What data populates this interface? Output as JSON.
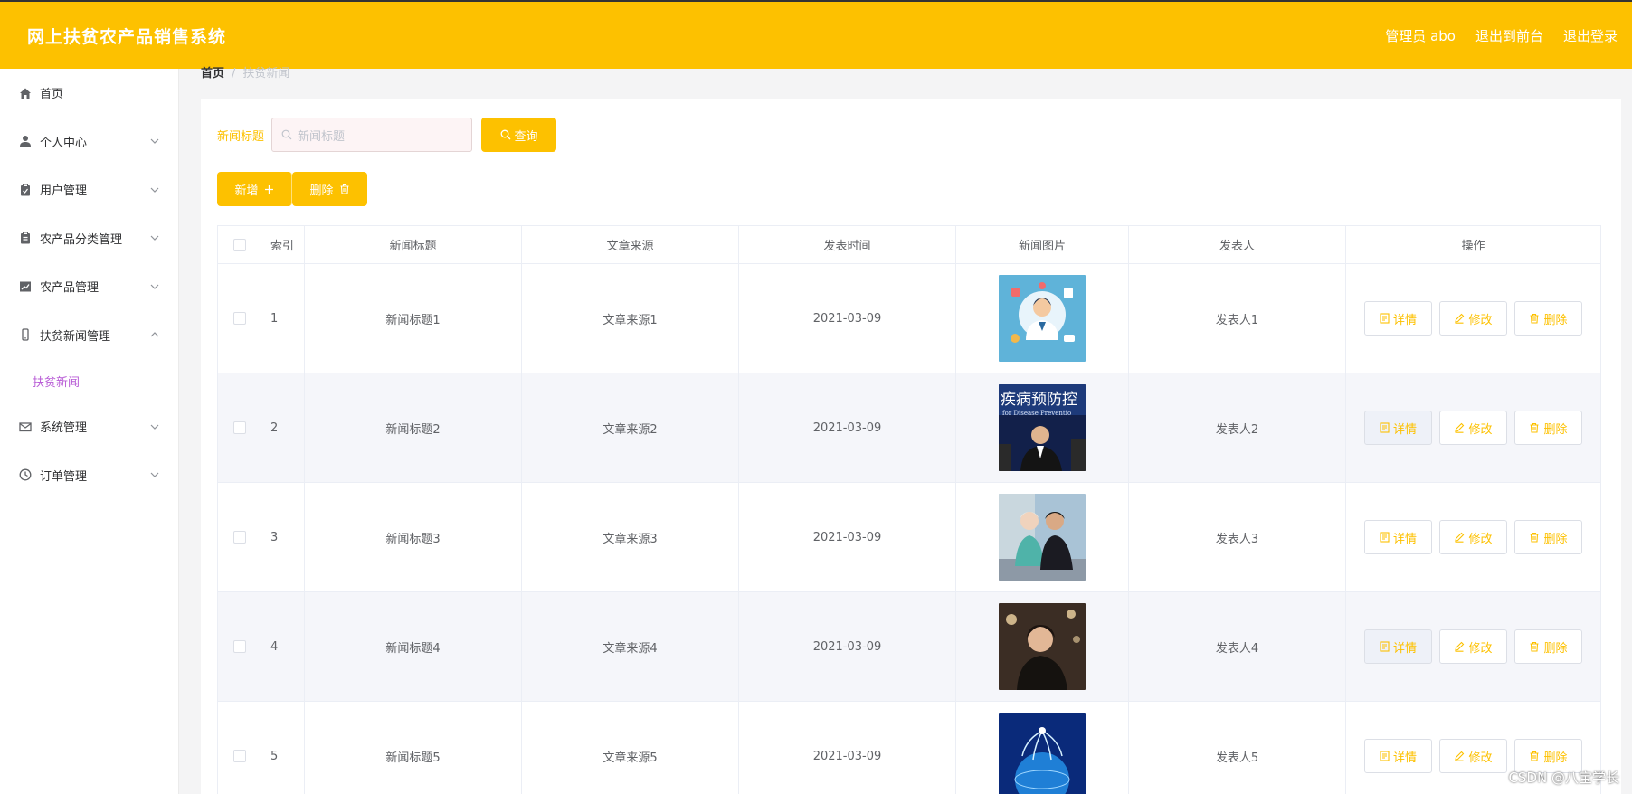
{
  "header": {
    "title": "网上扶贫农产品销售系统",
    "admin": "管理员 abo",
    "to_front": "退出到前台",
    "logout": "退出登录"
  },
  "sidebar": {
    "items": [
      {
        "label": "首页",
        "icon": "home-icon"
      },
      {
        "label": "个人中心",
        "icon": "user-icon"
      },
      {
        "label": "用户管理",
        "icon": "clipboard-icon"
      },
      {
        "label": "农产品分类管理",
        "icon": "clipboard-icon"
      },
      {
        "label": "农产品管理",
        "icon": "chart-icon"
      },
      {
        "label": "扶贫新闻管理",
        "icon": "phone-icon"
      },
      {
        "label": "系统管理",
        "icon": "mail-icon"
      },
      {
        "label": "订单管理",
        "icon": "clock-icon"
      }
    ],
    "submenu_active": "扶贫新闻"
  },
  "breadcrumb": {
    "home": "首页",
    "current": "扶贫新闻"
  },
  "search": {
    "label": "新闻标题",
    "placeholder": "新闻标题",
    "button": "查询"
  },
  "actions": {
    "add": "新增",
    "delete": "删除"
  },
  "table": {
    "headers": [
      "索引",
      "新闻标题",
      "文章来源",
      "发表时间",
      "新闻图片",
      "发表人",
      "操作"
    ],
    "rows": [
      {
        "index": "1",
        "title": "新闻标题1",
        "source": "文章来源1",
        "date": "2021-03-09",
        "author": "发表人1"
      },
      {
        "index": "2",
        "title": "新闻标题2",
        "source": "文章来源2",
        "date": "2021-03-09",
        "author": "发表人2"
      },
      {
        "index": "3",
        "title": "新闻标题3",
        "source": "文章来源3",
        "date": "2021-03-09",
        "author": "发表人3"
      },
      {
        "index": "4",
        "title": "新闻标题4",
        "source": "文章来源4",
        "date": "2021-03-09",
        "author": "发表人4"
      },
      {
        "index": "5",
        "title": "新闻标题5",
        "source": "文章来源5",
        "date": "2021-03-09",
        "author": "发表人5"
      }
    ],
    "ops": {
      "detail": "详情",
      "edit": "修改",
      "delete": "删除"
    }
  },
  "image_text": {
    "row2_sign": "疾病预防控",
    "row2_sign_en": "for Disease Preventio"
  },
  "watermark": "CSDN @八宝学长",
  "colors": {
    "accent": "#fdc100",
    "submenu_active": "#b85cd6"
  }
}
